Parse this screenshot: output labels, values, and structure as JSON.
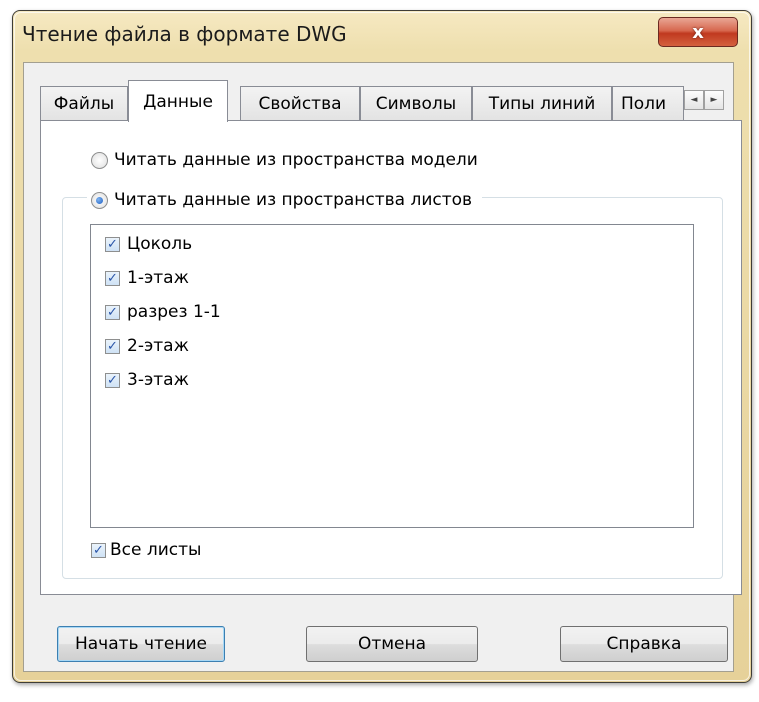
{
  "window": {
    "title": "Чтение файла в формате DWG",
    "close_label": "x"
  },
  "tabs": [
    {
      "label": "Файлы",
      "active": false
    },
    {
      "label": "Данные",
      "active": true
    },
    {
      "label": "Свойства",
      "active": false
    },
    {
      "label": "Символы",
      "active": false
    },
    {
      "label": "Типы линий",
      "active": false
    },
    {
      "label": "Поли",
      "active": false
    }
  ],
  "tab_scroll": {
    "left_icon": "◄",
    "right_icon": "►"
  },
  "source": {
    "model_space_label": "Читать данные из пространства модели",
    "model_space_checked": false,
    "paper_space_label": "Читать данные из пространства листов",
    "paper_space_checked": true
  },
  "sheets": [
    {
      "label": "Цоколь",
      "checked": true
    },
    {
      "label": "1-этаж",
      "checked": true
    },
    {
      "label": "разрез 1-1",
      "checked": true
    },
    {
      "label": "2-этаж",
      "checked": true
    },
    {
      "label": "3-этаж",
      "checked": true
    }
  ],
  "all_sheets": {
    "label": "Все листы",
    "checked": true
  },
  "buttons": {
    "start": "Начать чтение",
    "cancel": "Отмена",
    "help": "Справка"
  },
  "colors": {
    "title_bar": "#eedfae",
    "close_button": "#c0391f",
    "check_mark": "#2a55a8",
    "radio_dot": "#1f5fc4"
  }
}
